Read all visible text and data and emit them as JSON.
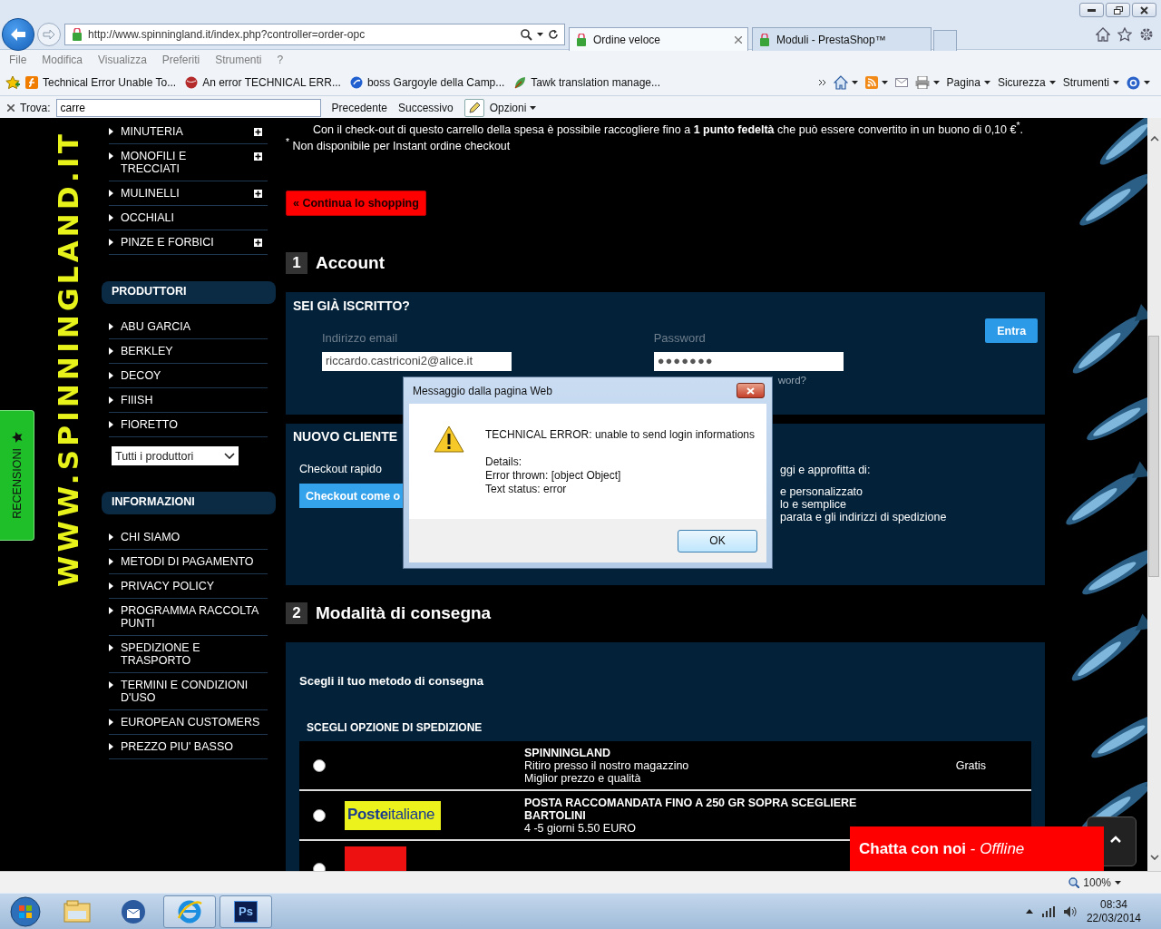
{
  "browser": {
    "address": "http://www.spinningland.it/index.php?controller=order-opc",
    "tabs": [
      {
        "label": "Ordine veloce",
        "selected": true
      },
      {
        "label": "Moduli - PrestaShop™",
        "selected": false
      }
    ],
    "menu": [
      "File",
      "Modifica",
      "Visualizza",
      "Preferiti",
      "Strumenti",
      "?"
    ],
    "favorites": [
      {
        "kind": "flash",
        "label": "Technical Error Unable To..."
      },
      {
        "kind": "ball",
        "label": "An error TECHNICAL ERR..."
      },
      {
        "kind": "globe",
        "label": "boss Gargoyle della Camp..."
      },
      {
        "kind": "leaf",
        "label": "Tawk translation manage..."
      }
    ],
    "commands": [
      "Pagina",
      "Sicurezza",
      "Strumenti"
    ],
    "find": {
      "label": "Trova:",
      "value": "carre",
      "buttons": [
        "Precedente",
        "Successivo"
      ],
      "options": "Opzioni"
    }
  },
  "logo": "WWW.SPINNINGLAND.IT",
  "reviews_tab": "RECENSIONI",
  "sidebar": {
    "categories": [
      {
        "label": "MINUTERIA",
        "expandable": true
      },
      {
        "label": "MONOFILI E TRECCIATI",
        "expandable": true
      },
      {
        "label": "MULINELLI",
        "expandable": true
      },
      {
        "label": "OCCHIALI",
        "expandable": false
      },
      {
        "label": "PINZE E FORBICI",
        "expandable": true
      }
    ],
    "sections": [
      {
        "title": "PRODUTTORI",
        "items": [
          "ABU GARCIA",
          "BERKLEY",
          "DECOY",
          "FIIISH",
          "FIORETTO"
        ],
        "select": "Tutti i produttori"
      },
      {
        "title": "INFORMAZIONI",
        "items": [
          "CHI SIAMO",
          "METODI DI PAGAMENTO",
          "PRIVACY POLICY",
          "PROGRAMMA RACCOLTA PUNTI",
          "SPEDIZIONE E TRASPORTO",
          "TERMINI E CONDIZIONI D'USO",
          "EUROPEAN CUSTOMERS",
          "PREZZO PIU' BASSO"
        ]
      }
    ]
  },
  "notice": "Con il check-out di questo carrello della spesa è possibile raccogliere fino a **1 punto fedeltà** che può essere convertito in un buono di 0,10 €$^{*}$.",
  "footnote": "$^{*}$ Non disponibile per Instant ordine checkout",
  "continue_button": "« Continua lo shopping",
  "account_step": {
    "number": "1",
    "title": "Account"
  },
  "login": {
    "title": "SEI GIÀ ISCRITTO?",
    "email_label": "Indirizzo email",
    "email": "riccardo.castriconi2@alice.it",
    "password_label": "Password",
    "password": "●●●●●●●",
    "forgot_fragment": "word?",
    "submit": "Entra"
  },
  "new_customer": {
    "title": "NUOVO CLIENTE",
    "subtitle": "Checkout rapido",
    "button": "Checkout come o",
    "fragments": [
      "ggi e approfitta di:",
      "e personalizzato",
      "lo e semplice",
      "parata e gli indirizzi di spedizione"
    ]
  },
  "delivery_step": {
    "number": "2",
    "title": "Modalità di consegna"
  },
  "delivery": {
    "prompt": "Scegli il tuo metodo di consegna",
    "options_title": "SCEGLI OPZIONE DI SPEDIZIONE",
    "carriers": [
      {
        "kind": "none",
        "selected": false,
        "name": "SPINNINGLAND",
        "lines": [
          "Ritiro presso il nostro magazzino",
          "Miglior prezzo e qualità"
        ],
        "price": "Gratis"
      },
      {
        "kind": "poste",
        "logo": "**Poste**italiane",
        "selected": false,
        "name": "POSTA RACCOMANDATA FINO A 250 GR SOPRA SCEGLIERE BARTOLINI",
        "lines": [
          "4 -5 giorni 5.50 EURO"
        ]
      },
      {
        "kind": "brt",
        "selected": false
      }
    ]
  },
  "chat": "**Chatta con noi** - *Offline*",
  "dialog": {
    "title": "Messaggio dalla pagina Web",
    "message": "TECHNICAL ERROR: unable to send login informations",
    "details": [
      "Details:",
      "Error thrown: [object Object]",
      "Text status: error"
    ],
    "button": "OK"
  },
  "status_bar": {
    "zoom": "100%"
  },
  "taskbar": {
    "apps": [
      {
        "kind": "explorer",
        "active": false
      },
      {
        "kind": "mail",
        "active": false
      },
      {
        "kind": "browser",
        "active": true
      },
      {
        "kind": "photoshop",
        "label": "Ps",
        "active": true
      }
    ],
    "time": "08:34",
    "date": "22/03/2014"
  }
}
